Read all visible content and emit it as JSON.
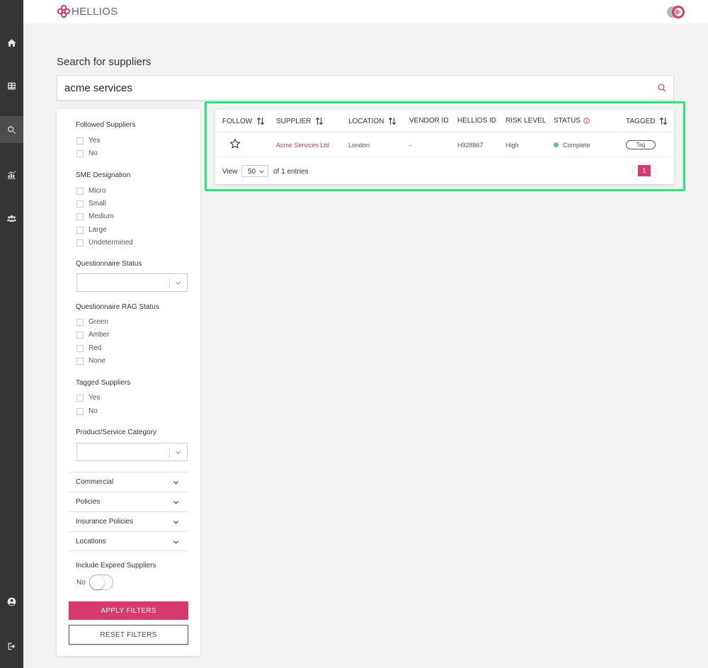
{
  "app": {
    "brand": "HELLIOS"
  },
  "nav": {
    "items": [
      {
        "name": "home",
        "icon": "home-icon"
      },
      {
        "name": "dashboard",
        "icon": "table-icon"
      },
      {
        "name": "search",
        "icon": "search-icon",
        "active": true
      },
      {
        "name": "analytics",
        "icon": "chart-icon"
      },
      {
        "name": "users",
        "icon": "users-icon"
      },
      {
        "name": "account",
        "icon": "user-circle-icon"
      },
      {
        "name": "logout",
        "icon": "logout-icon"
      }
    ]
  },
  "page": {
    "title": "Search for suppliers"
  },
  "search": {
    "value": "acme services",
    "placeholder": ""
  },
  "filters": {
    "followed": {
      "heading": "Followed Suppliers",
      "options": [
        "Yes",
        "No"
      ]
    },
    "sme": {
      "heading": "SME Designation",
      "options": [
        "Micro",
        "Small",
        "Medium",
        "Large",
        "Undetermined"
      ]
    },
    "questionnaire_status": {
      "heading": "Questionnaire Status",
      "value": ""
    },
    "rag": {
      "heading": "Questionnaire RAG Status",
      "options": [
        "Green",
        "Amber",
        "Red",
        "None"
      ]
    },
    "tagged": {
      "heading": "Tagged Suppliers",
      "options": [
        "Yes",
        "No"
      ]
    },
    "category": {
      "heading": "Product/Service Category",
      "value": ""
    },
    "accordions": [
      "Commercial",
      "Policies",
      "Insurance Policies",
      "Locations"
    ],
    "expired": {
      "heading": "Include Expired Suppliers",
      "toggle_label": "No",
      "on": false
    },
    "apply_label": "APPLY FILTERS",
    "reset_label": "RESET FILTERS"
  },
  "results": {
    "columns": {
      "follow": "FOLLOW",
      "supplier": "SUPPLIER",
      "location": "LOCATION",
      "vendor_id": "VENDOR ID",
      "hellios_id": "HELLIOS ID",
      "risk_level": "RISK LEVEL",
      "status": "STATUS",
      "tagged": "TAGGED"
    },
    "rows": [
      {
        "followed": false,
        "supplier": "Acme Services Ltd",
        "location": "London",
        "vendor_id": "-",
        "hellios_id": "H928867",
        "risk_level": "High",
        "status": "Complete",
        "tag_label": "Tag"
      }
    ],
    "pager": {
      "view_label": "View",
      "page_size": "50",
      "entries_label": "of 1 entries",
      "current_page": "1"
    }
  },
  "colors": {
    "accent": "#d63a6f",
    "status_complete": "#5bc97a",
    "highlight": "#27e57a",
    "rail": "#353535"
  }
}
